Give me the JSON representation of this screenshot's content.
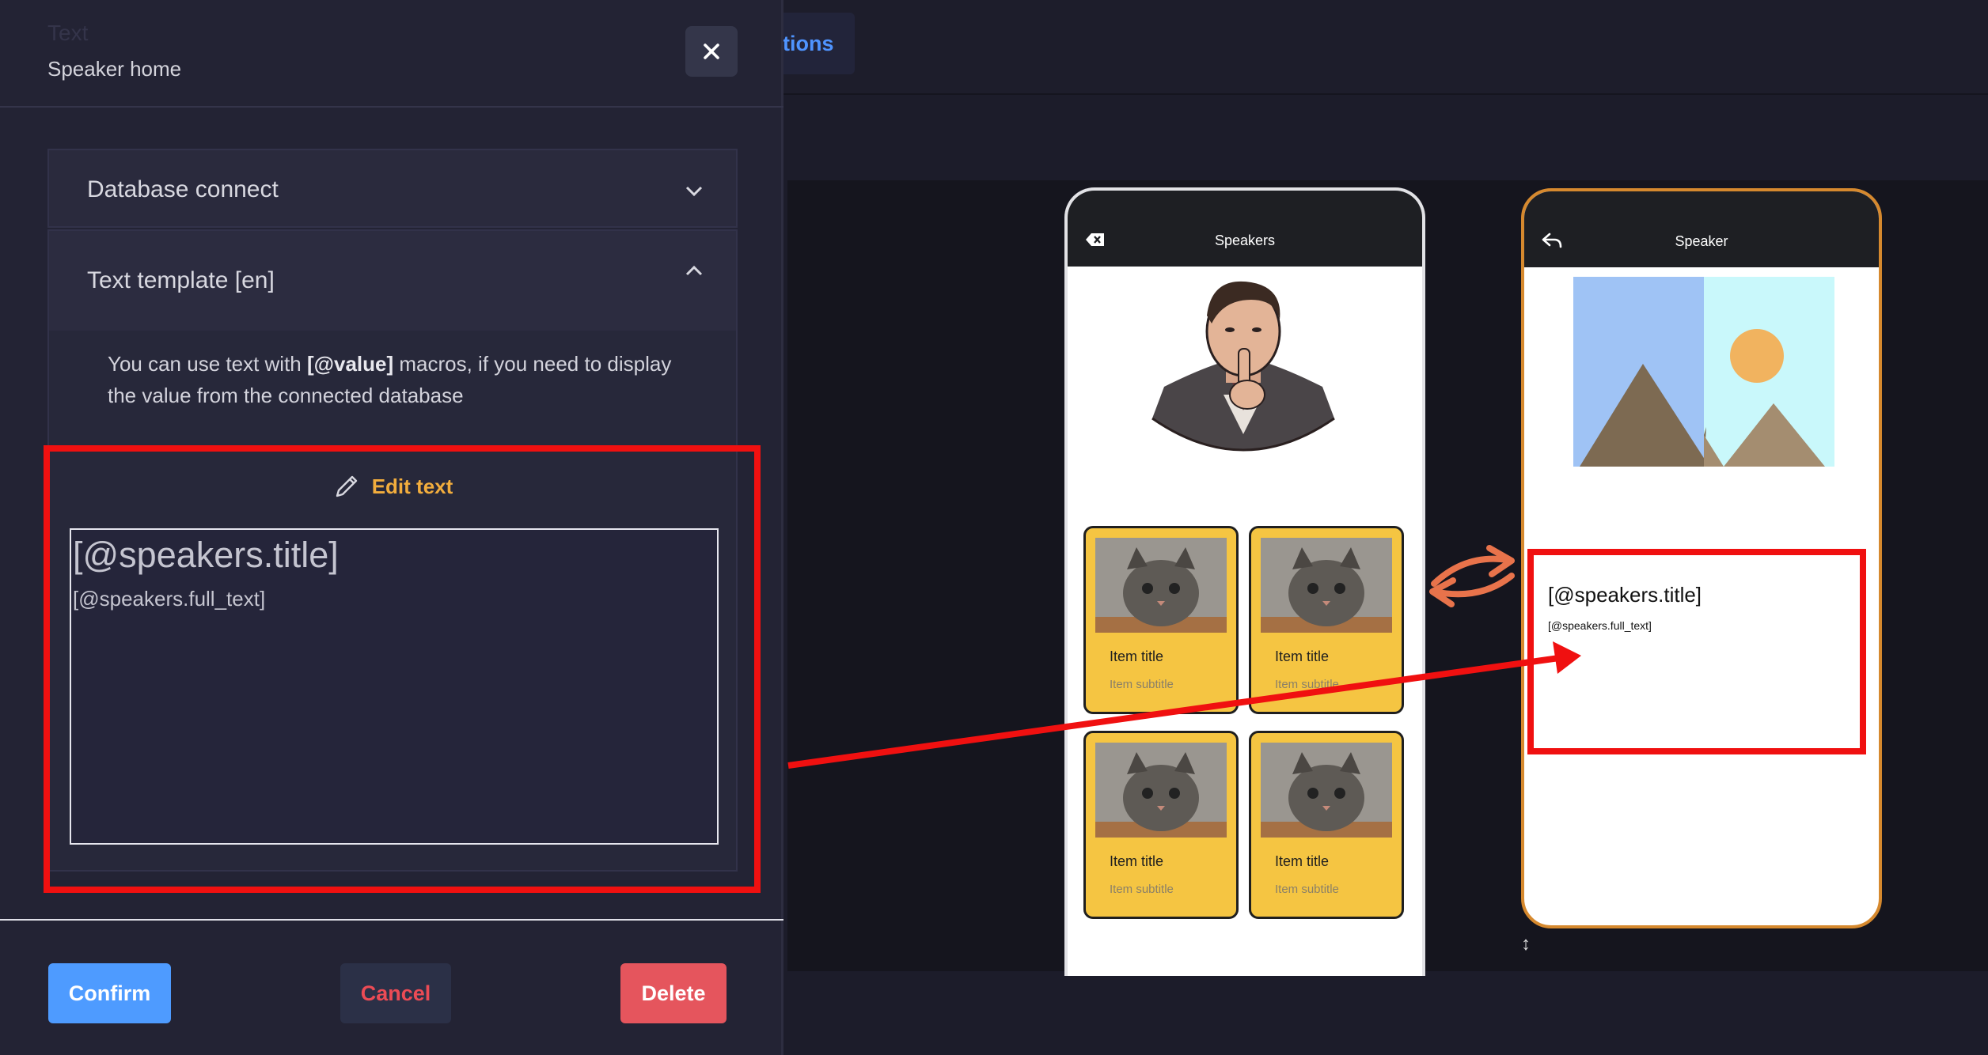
{
  "topbar": {
    "tab_label": "tions"
  },
  "modal": {
    "faded_title": "Text",
    "subtitle": "Speaker home",
    "close_icon": "close-icon",
    "accordion_db": {
      "label": "Database connect",
      "icon": "chevron-down-icon"
    },
    "accordion_tt": {
      "label": "Text template [en]",
      "icon": "chevron-up-icon",
      "help_pre": "You can use text with ",
      "help_macro": "[@value]",
      "help_post": " macros, if you need to display the value from the connected database",
      "edit_label": "Edit text",
      "edit_icon": "pencil-icon",
      "editor_title": "[@speakers.title]",
      "editor_full": "[@speakers.full_text]"
    },
    "buttons": {
      "confirm": "Confirm",
      "cancel": "Cancel",
      "delete": "Delete"
    }
  },
  "phone1": {
    "header": "Speakers",
    "header_icon": "backspace-icon",
    "cards": [
      {
        "title": "Item title",
        "subtitle": "Item subtitle"
      },
      {
        "title": "Item title",
        "subtitle": "Item subtitle"
      },
      {
        "title": "Item title",
        "subtitle": "Item subtitle"
      },
      {
        "title": "Item title",
        "subtitle": "Item subtitle"
      }
    ]
  },
  "phone2": {
    "header": "Speaker",
    "header_icon": "back-arrow-icon",
    "title": "[@speakers.title]",
    "full_text": "[@speakers.full_text]"
  },
  "colors": {
    "accent": "#4e9bff",
    "danger": "#e5555d",
    "highlight": "#f01010",
    "card": "#f5c542",
    "edit": "#f2ad3d"
  }
}
